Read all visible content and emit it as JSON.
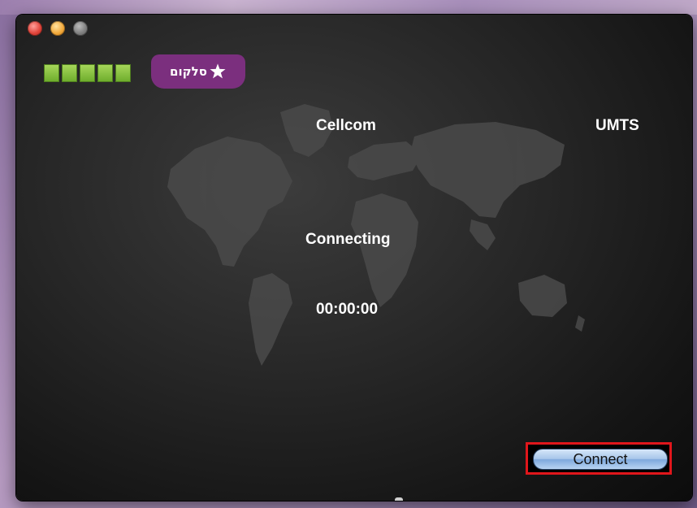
{
  "window": {
    "controls": [
      {
        "name": "close",
        "color": "#e0443a"
      },
      {
        "name": "minimize",
        "color": "#f2a93b"
      },
      {
        "name": "zoom",
        "color": "#7f7f7f"
      }
    ]
  },
  "signal": {
    "bars_total": 5,
    "bars_active": 5,
    "color": "#8cc63f"
  },
  "logo": {
    "text": "סלקום",
    "bg_color": "#7b2f7e"
  },
  "connection": {
    "operator": "Cellcom",
    "technology": "UMTS",
    "status": "Connecting",
    "timer": "00:00:00"
  },
  "actions": {
    "connect_label": "Connect"
  },
  "highlight": {
    "color": "#e0161b"
  }
}
